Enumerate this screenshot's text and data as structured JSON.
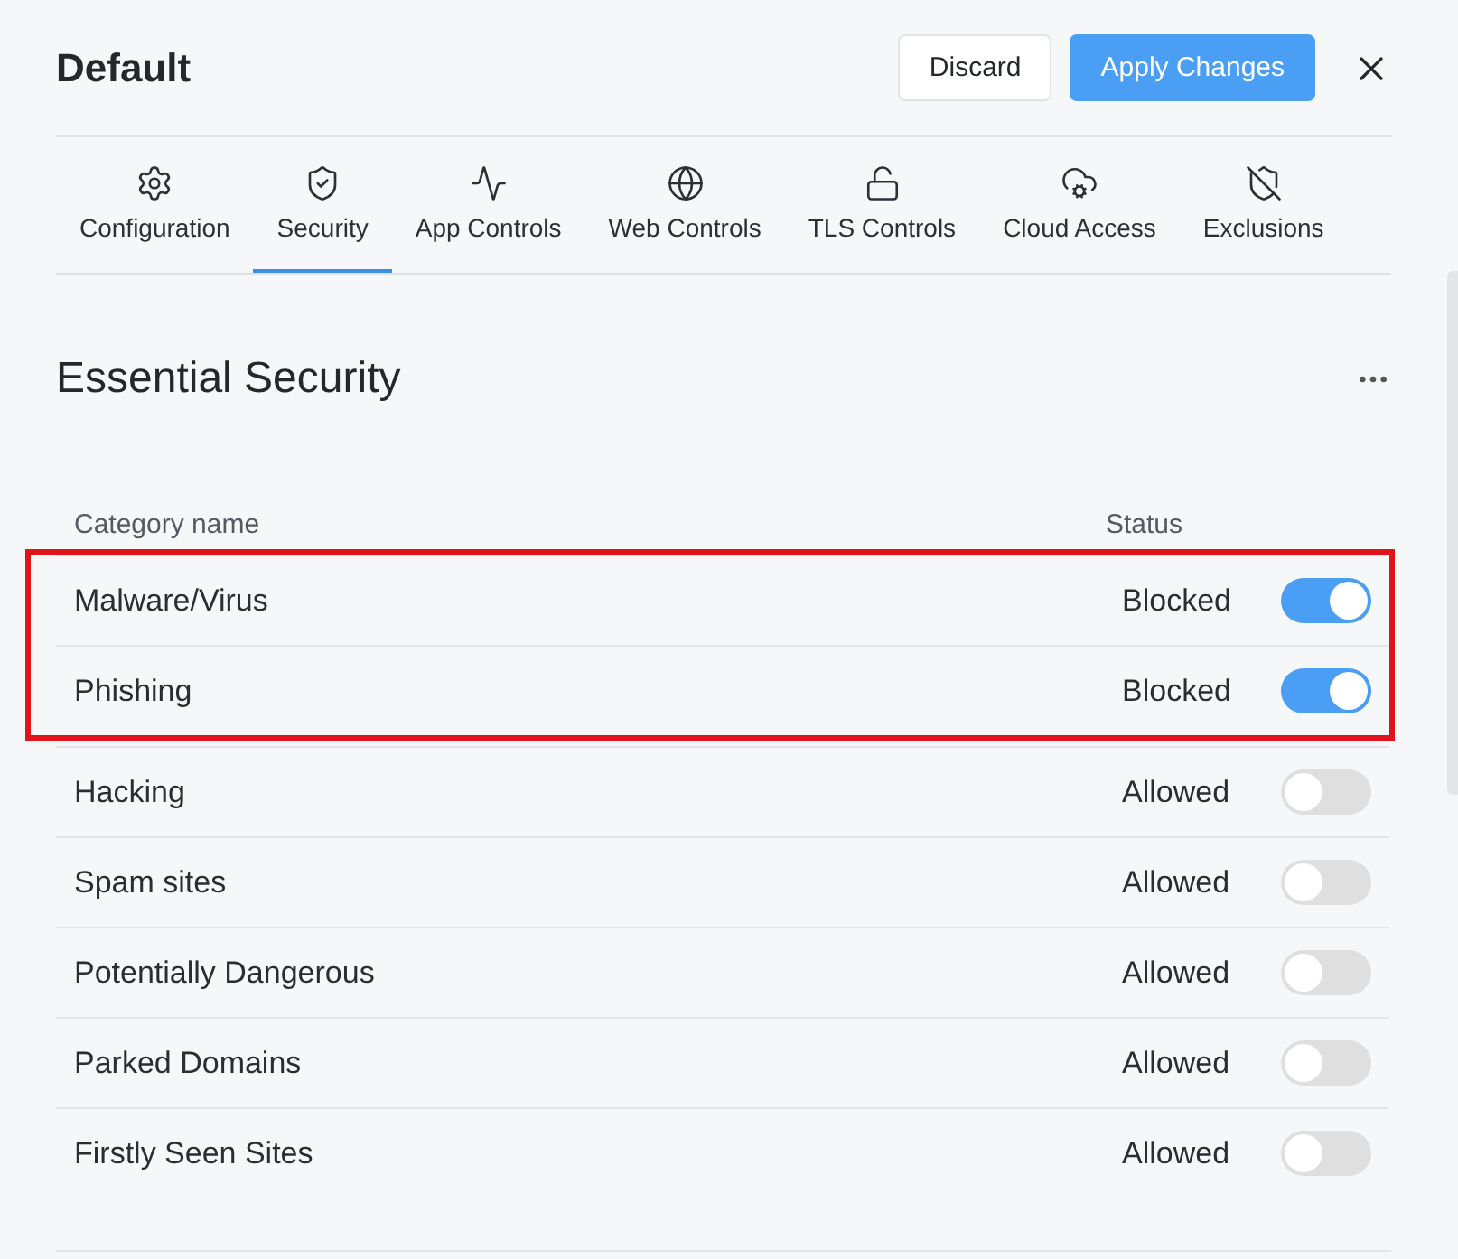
{
  "header": {
    "title": "Default",
    "buttons": [
      {
        "label": "Discard",
        "kind": "secondary"
      },
      {
        "label": "Apply Changes",
        "kind": "primary"
      }
    ]
  },
  "tabs": [
    {
      "label": "Configuration",
      "selected": false
    },
    {
      "label": "Security",
      "selected": true
    },
    {
      "label": "App Controls",
      "selected": false
    },
    {
      "label": "Web Controls",
      "selected": false
    },
    {
      "label": "TLS Controls",
      "selected": false
    },
    {
      "label": "Cloud Access",
      "selected": false
    },
    {
      "label": "Exclusions",
      "selected": false
    }
  ],
  "section": {
    "title": "Essential Security"
  },
  "table": {
    "columns": [
      "Category name",
      "Status"
    ],
    "rows": [
      {
        "name": "Malware/Virus",
        "status": "Blocked",
        "on": true,
        "highlighted": true
      },
      {
        "name": "Phishing",
        "status": "Blocked",
        "on": true,
        "highlighted": true
      },
      {
        "name": "Hacking",
        "status": "Allowed",
        "on": false,
        "highlighted": false
      },
      {
        "name": "Spam sites",
        "status": "Allowed",
        "on": false,
        "highlighted": false
      },
      {
        "name": "Potentially Dangerous",
        "status": "Allowed",
        "on": false,
        "highlighted": false
      },
      {
        "name": "Parked Domains",
        "status": "Allowed",
        "on": false,
        "highlighted": false
      },
      {
        "name": "Firstly Seen Sites",
        "status": "Allowed",
        "on": false,
        "highlighted": false
      }
    ]
  }
}
